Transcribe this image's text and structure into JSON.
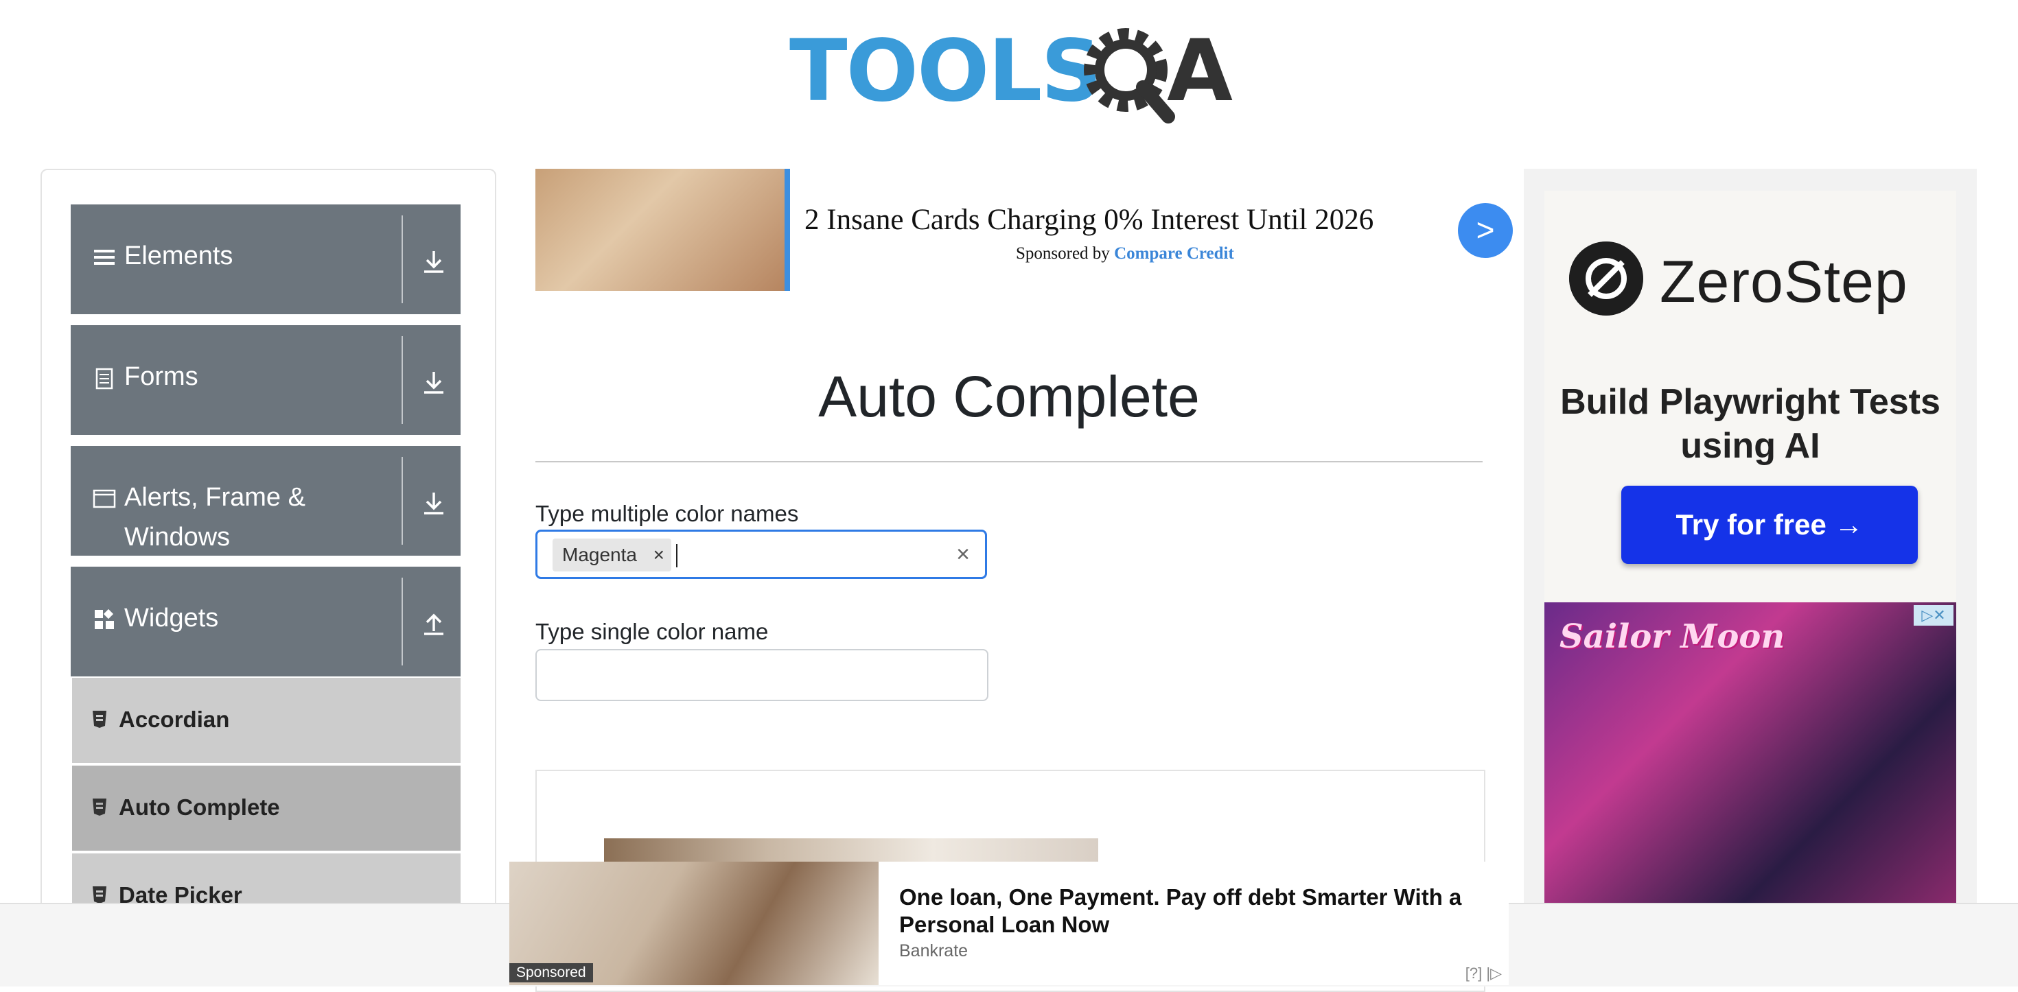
{
  "logo": {
    "tools": "TOOLS",
    "a": "A"
  },
  "sidebar": {
    "groups": [
      {
        "label": "Elements",
        "icon": "hamburger-icon",
        "expanded": false
      },
      {
        "label": "Forms",
        "icon": "document-icon",
        "expanded": false
      },
      {
        "label": "Alerts, Frame & Windows",
        "icon": "window-icon",
        "expanded": false
      },
      {
        "label": "Widgets",
        "icon": "widgets-icon",
        "expanded": true
      }
    ],
    "items": [
      {
        "label": "Accordian",
        "active": false
      },
      {
        "label": "Auto Complete",
        "active": true
      },
      {
        "label": "Date Picker",
        "active": false
      }
    ]
  },
  "top_ad": {
    "headline": "2 Insane Cards Charging 0% Interest Until 2026",
    "sponsored_prefix": "Sponsored by",
    "sponsor": "Compare Credit",
    "go_label": ">"
  },
  "main": {
    "title": "Auto Complete",
    "multi_label": "Type multiple color names",
    "multi_chips": [
      "Magenta"
    ],
    "chip_remove": "×",
    "clear_label": "×",
    "single_label": "Type single color name",
    "single_value": ""
  },
  "right_ad": {
    "brand": "ZeroStep",
    "tagline": "Build Playwright Tests using AI",
    "cta": "Try for free →",
    "second_ad_text": "Sailor Moon",
    "ad_choices": "▷✕"
  },
  "bottom_ad": {
    "sponsored": "Sponsored",
    "headline": "One loan, One Payment. Pay off debt Smarter With a Personal Loan Now",
    "source": "Bankrate",
    "marker": "[?] |▷"
  },
  "colors": {
    "sidebar_group": "#6c757d",
    "sidebar_item": "#cccccc",
    "sidebar_item_active": "#b3b3b3",
    "focus_border": "#2f7ae5",
    "logo_blue": "#3a9bd9",
    "cta_blue": "#1533e8"
  }
}
